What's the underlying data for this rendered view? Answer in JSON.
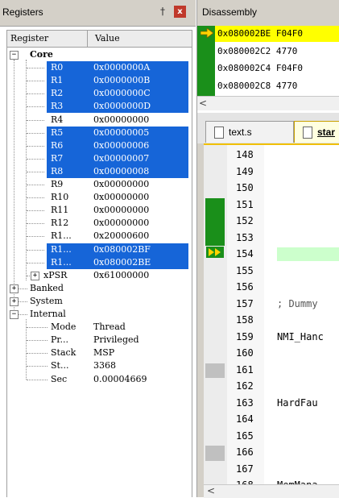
{
  "registers": {
    "title": "Registers",
    "pin_glyph": "†",
    "close_glyph": "x",
    "col_register": "Register",
    "col_value": "Value",
    "core_label": "Core",
    "core": [
      {
        "name": "R0",
        "value": "0x0000000A",
        "selected": true
      },
      {
        "name": "R1",
        "value": "0x0000000B",
        "selected": true
      },
      {
        "name": "R2",
        "value": "0x0000000C",
        "selected": true
      },
      {
        "name": "R3",
        "value": "0x0000000D",
        "selected": true
      },
      {
        "name": "R4",
        "value": "0x00000000",
        "selected": false
      },
      {
        "name": "R5",
        "value": "0x00000005",
        "selected": true
      },
      {
        "name": "R6",
        "value": "0x00000006",
        "selected": true
      },
      {
        "name": "R7",
        "value": "0x00000007",
        "selected": true
      },
      {
        "name": "R8",
        "value": "0x00000008",
        "selected": true
      },
      {
        "name": "R9",
        "value": "0x00000000",
        "selected": false
      },
      {
        "name": "R10",
        "value": "0x00000000",
        "selected": false
      },
      {
        "name": "R11",
        "value": "0x00000000",
        "selected": false
      },
      {
        "name": "R12",
        "value": "0x00000000",
        "selected": false
      },
      {
        "name": "R1...",
        "value": "0x20000600",
        "selected": false
      },
      {
        "name": "R1...",
        "value": "0x080002BF",
        "selected": true
      },
      {
        "name": "R1...",
        "value": "0x080002BE",
        "selected": true
      }
    ],
    "xpsr": {
      "name": "xPSR",
      "value": "0x61000000"
    },
    "groups": [
      "Banked",
      "System",
      "Internal"
    ],
    "internal": [
      {
        "name": "Mode",
        "value": "Thread"
      },
      {
        "name": "Pr...",
        "value": "Privileged"
      },
      {
        "name": "Stack",
        "value": "MSP"
      },
      {
        "name": "St...",
        "value": "3368"
      },
      {
        "name": "Sec",
        "value": "0.00004669"
      }
    ]
  },
  "disassembly": {
    "title": "Disassembly",
    "lines": [
      {
        "text": "0x080002BE F04F0",
        "current": true
      },
      {
        "text": "0x080002C2 4770",
        "current": false
      },
      {
        "text": "0x080002C4 F04F0",
        "current": false
      },
      {
        "text": "0x080002C8 4770",
        "current": false
      }
    ],
    "scroll_left_glyph": "<"
  },
  "editor": {
    "tabs": [
      {
        "label": "text.s",
        "active": false
      },
      {
        "label": "star",
        "active": true
      }
    ],
    "lines": [
      {
        "num": "148",
        "text": ""
      },
      {
        "num": "149",
        "text": ""
      },
      {
        "num": "150",
        "text": ""
      },
      {
        "num": "151",
        "text": ""
      },
      {
        "num": "152",
        "text": ""
      },
      {
        "num": "153",
        "text": ""
      },
      {
        "num": "154",
        "text": ""
      },
      {
        "num": "155",
        "text": ""
      },
      {
        "num": "156",
        "text": ""
      },
      {
        "num": "157",
        "text": "; Dummy"
      },
      {
        "num": "158",
        "text": ""
      },
      {
        "num": "159",
        "text": "NMI_Hanc"
      },
      {
        "num": "160",
        "text": ""
      },
      {
        "num": "161",
        "text": ""
      },
      {
        "num": "162",
        "text": ""
      },
      {
        "num": "163",
        "text": "HardFau"
      },
      {
        "num": "164",
        "text": ""
      },
      {
        "num": "165",
        "text": ""
      },
      {
        "num": "166",
        "text": ""
      },
      {
        "num": "167",
        "text": ""
      },
      {
        "num": "168",
        "text": "MemMana"
      }
    ],
    "current_line": "154",
    "scroll_left_glyph": "<"
  },
  "colors": {
    "selection": "#1665d8",
    "current_line": "#ffff00",
    "exec_margin": "#1a8f1a",
    "pc_marker": "#ffd400",
    "line_highlight": "#ccffcc"
  }
}
